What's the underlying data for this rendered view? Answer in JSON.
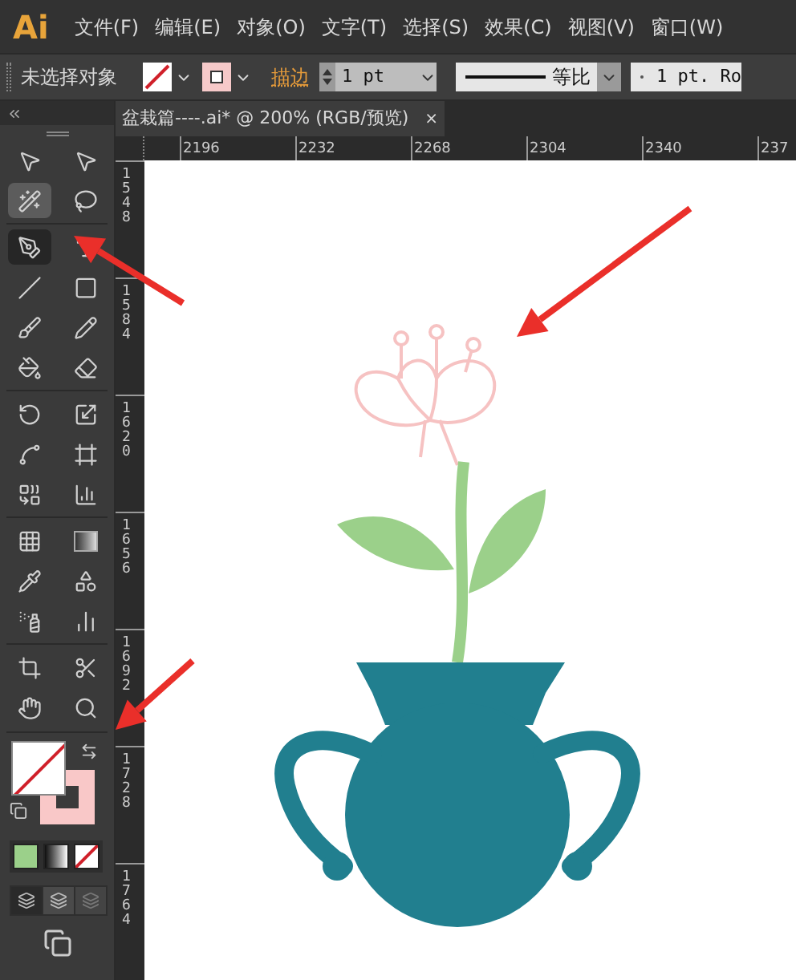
{
  "app_logo": "Ai",
  "menu": [
    "文件(F)",
    "编辑(E)",
    "对象(O)",
    "文字(T)",
    "选择(S)",
    "效果(C)",
    "视图(V)",
    "窗口(W)"
  ],
  "control_bar": {
    "selection_label": "未选择对象",
    "stroke_label": "描边",
    "stroke_weight": "1 pt",
    "profile_label": "等比",
    "brush_label": "1 pt. Ro"
  },
  "document_tab": {
    "title": "盆栽篇----.ai* @ 200% (RGB/预览)",
    "close": "×"
  },
  "ruler": {
    "horizontal": [
      "2196",
      "2232",
      "2268",
      "2304",
      "2340",
      "237"
    ],
    "vertical": [
      "1548",
      "1584",
      "1620",
      "1656",
      "1692",
      "1728",
      "1764"
    ]
  },
  "tools": [
    {
      "selected": false,
      "highlighted": false
    },
    {
      "selected": false,
      "highlighted": false
    },
    {
      "selected": false,
      "highlighted": true
    },
    {
      "selected": false,
      "highlighted": false
    },
    {
      "selected": true,
      "highlighted": false
    },
    {
      "selected": false,
      "highlighted": false
    },
    {
      "selected": false,
      "highlighted": false
    },
    {
      "selected": false,
      "highlighted": false
    },
    {
      "selected": false,
      "highlighted": false
    },
    {
      "selected": false,
      "highlighted": false
    },
    {
      "selected": false,
      "highlighted": false
    },
    {
      "selected": false,
      "highlighted": false
    },
    {
      "selected": false,
      "highlighted": false
    },
    {
      "selected": false,
      "highlighted": false
    },
    {
      "selected": false,
      "highlighted": false
    },
    {
      "selected": false,
      "highlighted": false
    },
    {
      "selected": false,
      "highlighted": false
    },
    {
      "selected": false,
      "highlighted": false
    },
    {
      "selected": false,
      "highlighted": false
    },
    {
      "selected": false,
      "highlighted": false
    },
    {
      "selected": false,
      "highlighted": false
    },
    {
      "selected": false,
      "highlighted": false
    },
    {
      "selected": false,
      "highlighted": false
    },
    {
      "selected": false,
      "highlighted": false
    },
    {
      "selected": false,
      "highlighted": false
    },
    {
      "selected": false,
      "highlighted": false
    },
    {
      "selected": false,
      "highlighted": false
    },
    {
      "selected": false,
      "highlighted": false
    }
  ]
}
